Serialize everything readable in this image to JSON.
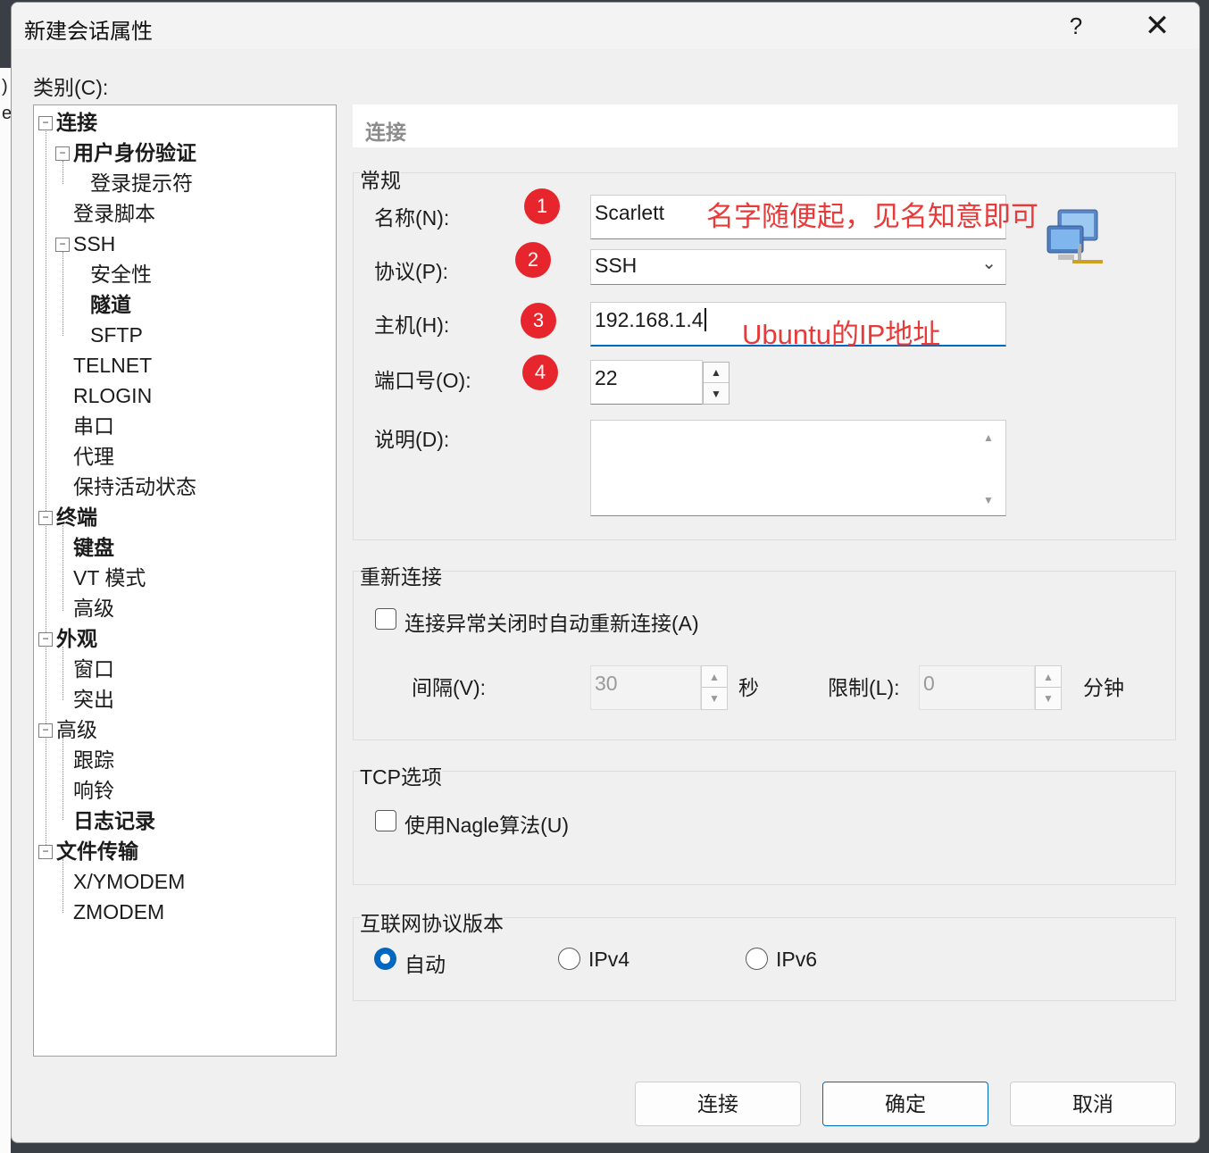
{
  "background": {
    "chars": [
      ")",
      "e"
    ]
  },
  "window": {
    "title": "新建会话属性",
    "help": "?",
    "close": "✕"
  },
  "category_label": "类别(C):",
  "tree": {
    "connection": "连接",
    "auth": "用户身份验证",
    "login_prompt": "登录提示符",
    "login_script": "登录脚本",
    "ssh": "SSH",
    "security": "安全性",
    "tunnel": "隧道",
    "sftp": "SFTP",
    "telnet": "TELNET",
    "rlogin": "RLOGIN",
    "serial": "串口",
    "proxy": "代理",
    "keepalive": "保持活动状态",
    "terminal": "终端",
    "keyboard": "键盘",
    "vt_mode": "VT 模式",
    "terminal_advanced": "高级",
    "appearance": "外观",
    "window_item": "窗口",
    "highlight": "突出",
    "advanced": "高级",
    "trace": "跟踪",
    "bell": "响铃",
    "logging": "日志记录",
    "file_transfer": "文件传输",
    "xymodem": "X/YMODEM",
    "zmodem": "ZMODEM",
    "expander_symbol": "−"
  },
  "panel_header": "连接",
  "general": {
    "title": "常规",
    "name_label": "名称(N):",
    "name_value": "Scarlett",
    "protocol_label": "协议(P):",
    "protocol_value": "SSH",
    "host_label": "主机(H):",
    "host_value": "192.168.1.4",
    "port_label": "端口号(O):",
    "port_value": "22",
    "desc_label": "说明(D):",
    "desc_value": ""
  },
  "annotations": {
    "badges": [
      "1",
      "2",
      "3",
      "4"
    ],
    "name_note": "名字随便起，见名知意即可",
    "host_note": "Ubuntu的IP地址"
  },
  "reconnect": {
    "title": "重新连接",
    "checkbox_label": "连接异常关闭时自动重新连接(A)",
    "checked": false,
    "interval_label": "间隔(V):",
    "interval_value": "30",
    "interval_unit": "秒",
    "limit_label": "限制(L):",
    "limit_value": "0",
    "limit_unit": "分钟"
  },
  "tcp": {
    "title": "TCP选项",
    "nagle_label": "使用Nagle算法(U)",
    "checked": false
  },
  "ip_version": {
    "title": "互联网协议版本",
    "options": [
      "自动",
      "IPv4",
      "IPv6"
    ],
    "selected": "自动"
  },
  "buttons": {
    "connect": "连接",
    "ok": "确定",
    "cancel": "取消"
  },
  "icons": {
    "spin_up": "▲",
    "spin_down": "▼",
    "dropdown": "⌄",
    "scroll_up": "▲",
    "scroll_down": "▼"
  },
  "colors": {
    "accent": "#0067c0",
    "annotation": "#e93a3a",
    "badge": "#e6262c"
  }
}
